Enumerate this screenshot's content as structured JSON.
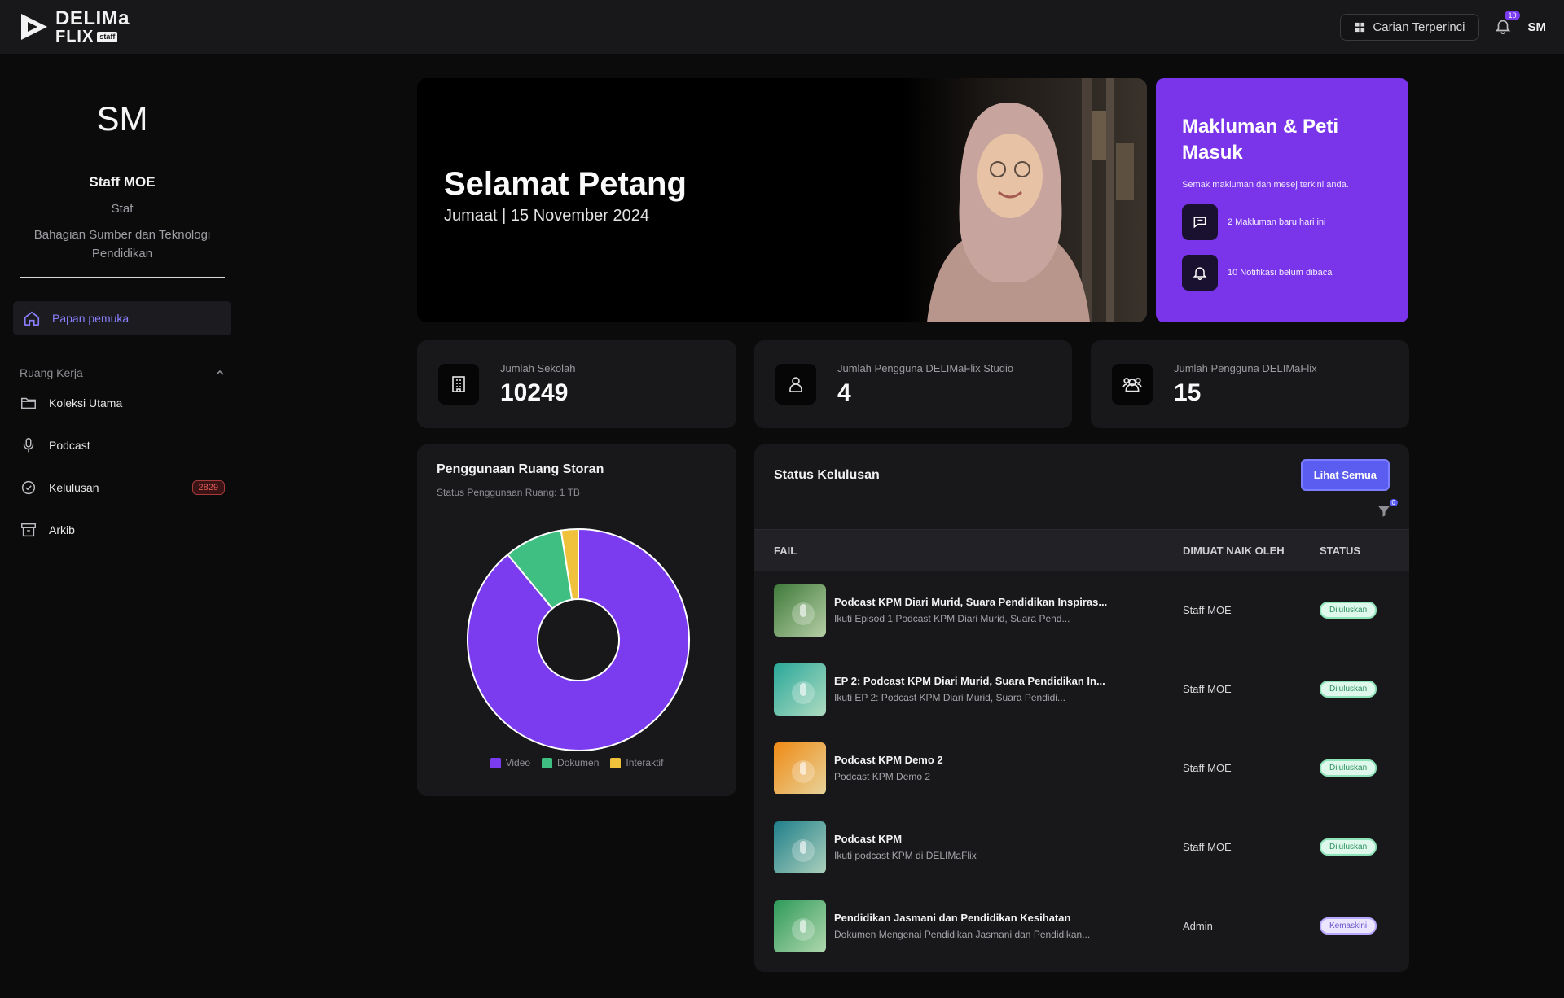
{
  "header": {
    "logo_line1": "DELIMa",
    "logo_line2": "FLIX",
    "logo_tag": "staff",
    "search_label": "Carian Terperinci",
    "notification_count": "10",
    "user_initials": "SM"
  },
  "sidebar": {
    "initials": "SM",
    "name": "Staff MOE",
    "role": "Staf",
    "department": "Bahagian Sumber dan Teknologi Pendidikan",
    "home_label": "Papan pemuka",
    "workspace_label": "Ruang Kerja",
    "items": [
      {
        "label": "Koleksi Utama",
        "icon": "folder-icon"
      },
      {
        "label": "Podcast",
        "icon": "microphone-icon"
      },
      {
        "label": "Kelulusan",
        "icon": "check-circle-icon",
        "badge": "2829"
      },
      {
        "label": "Arkib",
        "icon": "archive-icon"
      }
    ]
  },
  "hero": {
    "greeting": "Selamat Petang",
    "date": "Jumaat | 15 November 2024"
  },
  "notice": {
    "title": "Makluman & Peti Masuk",
    "subtitle": "Semak makluman dan mesej terkini anda.",
    "messages": "2 Makluman baru hari ini",
    "notifications": "10 Notifikasi belum dibaca",
    "color": "#7a35ea"
  },
  "stats": [
    {
      "label": "Jumlah Sekolah",
      "value": "10249",
      "icon": "building-icon"
    },
    {
      "label": "Jumlah Pengguna DELIMaFlix Studio",
      "value": "4",
      "icon": "user-icon"
    },
    {
      "label": "Jumlah Pengguna DELIMaFlix",
      "value": "15",
      "icon": "users-icon"
    }
  ],
  "storage": {
    "title": "Penggunaan Ruang Storan",
    "subtitle": "Status Penggunaan Ruang: 1 TB"
  },
  "chart_data": {
    "type": "pie",
    "categories": [
      "Video",
      "Dokumen",
      "Interaktif"
    ],
    "values": [
      89,
      8.5,
      2.5
    ],
    "colors": [
      "#7b3cf0",
      "#3fbf82",
      "#f0c23c"
    ],
    "legend_position": "bottom"
  },
  "status": {
    "title": "Status Kelulusan",
    "see_all": "Lihat Semua",
    "filter_count": "0",
    "columns": {
      "file": "FAIL",
      "uploaded_by": "DIMUAT NAIK OLEH",
      "status": "STATUS"
    },
    "rows": [
      {
        "title": "Podcast KPM Diari Murid, Suara Pendidikan Inspiras...",
        "desc": "Ikuti Episod 1 Podcast KPM Diari Murid, Suara Pend...",
        "by": "Staff MOE",
        "status": "Diluluskan",
        "kind": "ok",
        "thumb": "#3f7a3a"
      },
      {
        "title": "EP 2: Podcast KPM Diari Murid, Suara Pendidikan In...",
        "desc": "Ikuti EP 2: Podcast KPM Diari Murid, Suara Pendidi...",
        "by": "Staff MOE",
        "status": "Diluluskan",
        "kind": "ok",
        "thumb": "#2aa89a"
      },
      {
        "title": "Podcast KPM Demo 2",
        "desc": "Podcast KPM Demo 2",
        "by": "Staff MOE",
        "status": "Diluluskan",
        "kind": "ok",
        "thumb": "#f08a14"
      },
      {
        "title": "Podcast KPM",
        "desc": "Ikuti podcast KPM di DELIMaFlix",
        "by": "Staff MOE",
        "status": "Diluluskan",
        "kind": "ok",
        "thumb": "#1f7f8a"
      },
      {
        "title": "Pendidikan Jasmani dan Pendidikan Kesihatan",
        "desc": "Dokumen Mengenai Pendidikan Jasmani dan Pendidikan...",
        "by": "Admin",
        "status": "Kemaskini",
        "kind": "draft",
        "thumb": "#2f9a5a"
      }
    ]
  }
}
